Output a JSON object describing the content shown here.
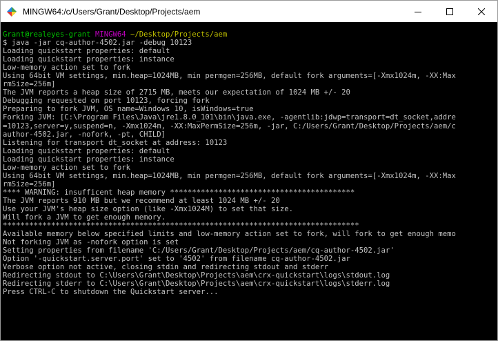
{
  "window": {
    "title": "MINGW64:/c/Users/Grant/Desktop/Projects/aem"
  },
  "icons": {
    "app": "mingw-app-icon",
    "minimize": "minimize-icon",
    "maximize": "maximize-icon",
    "close": "close-icon"
  },
  "colors": {
    "prompt_user": "#00bf00",
    "prompt_system": "#bf00bf",
    "prompt_path": "#bfbf00",
    "text": "#c0c0c0",
    "background": "#000000"
  },
  "terminal": {
    "prompt": {
      "user": "Grant@realeyes-grant",
      "system": "MINGW64",
      "path": "~/Desktop/Projects/aem"
    },
    "lines": [
      "$ java -jar cq-author-4502.jar -debug 10123",
      "Loading quickstart properties: default",
      "Loading quickstart properties: instance",
      "Low-memory action set to fork",
      "Using 64bit VM settings, min.heap=1024MB, min permgen=256MB, default fork arguments=[-Xmx1024m, -XX:Max",
      "rmSize=256m]",
      "The JVM reports a heap size of 2715 MB, meets our expectation of 1024 MB +/- 20",
      "Debugging requested on port 10123, forcing fork",
      "Preparing to fork JVM, OS name=Windows 10, isWindows=true",
      "Forking JVM: [C:\\Program Files\\Java\\jre1.8.0_101\\bin\\java.exe, -agentlib:jdwp=transport=dt_socket,addre",
      "=10123,server=y,suspend=n, -Xmx1024m, -XX:MaxPermSize=256m, -jar, C:/Users/Grant/Desktop/Projects/aem/c",
      "author-4502.jar, -nofork, -pt, CHILD]",
      "Listening for transport dt_socket at address: 10123",
      "Loading quickstart properties: default",
      "Loading quickstart properties: instance",
      "Low-memory action set to fork",
      "Using 64bit VM settings, min.heap=1024MB, min permgen=256MB, default fork arguments=[-Xmx1024m, -XX:Max",
      "rmSize=256m]",
      "**** WARNING: insufficent heap memory ******************************************",
      "The JVM reports 910 MB but we recommend at least 1024 MB +/- 20",
      "Use your JVM's heap size option (like -Xmx1024M) to set that size.",
      "Will fork a JVM to get enough memory.",
      "*********************************************************************************",
      "Available memory below specified limits and low-memory action set to fork, will fork to get enough memo",
      "Not forking JVM as -nofork option is set",
      "Setting properties from filename 'C:/Users/Grant/Desktop/Projects/aem/cq-author-4502.jar'",
      "Option '-quickstart.server.port' set to '4502' from filename cq-author-4502.jar",
      "Verbose option not active, closing stdin and redirecting stdout and stderr",
      "Redirecting stdout to C:\\Users\\Grant\\Desktop\\Projects\\aem\\crx-quickstart\\logs\\stdout.log",
      "Redirecting stderr to C:\\Users\\Grant\\Desktop\\Projects\\aem\\crx-quickstart\\logs\\stderr.log",
      "Press CTRL-C to shutdown the Quickstart server..."
    ]
  }
}
